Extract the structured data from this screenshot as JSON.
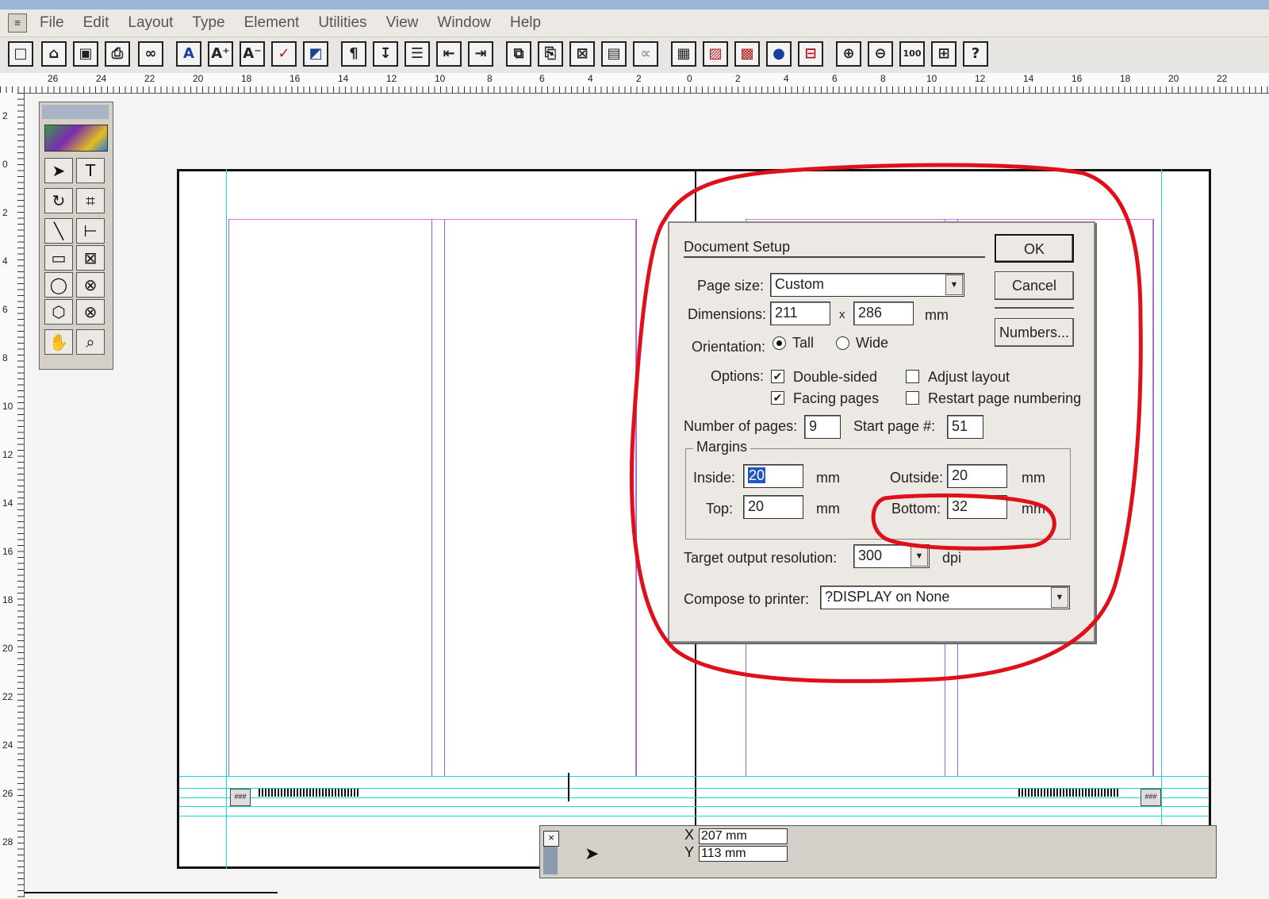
{
  "menubar": {
    "items": [
      "File",
      "Edit",
      "Layout",
      "Type",
      "Element",
      "Utilities",
      "View",
      "Window",
      "Help"
    ]
  },
  "rulers": {
    "horizontal_ticks": [
      "26",
      "24",
      "22",
      "20",
      "18",
      "16",
      "14",
      "12",
      "10",
      "8",
      "6",
      "4",
      "2",
      "0",
      "2",
      "4",
      "6",
      "8",
      "10",
      "12",
      "14",
      "16",
      "18",
      "20",
      "22"
    ],
    "vertical_ticks": [
      "2",
      "0",
      "2",
      "4",
      "6",
      "8",
      "10",
      "12",
      "14",
      "16",
      "18",
      "20",
      "22",
      "24",
      "26",
      "28"
    ]
  },
  "dialog": {
    "title": "Document Setup",
    "page_size_label": "Page size:",
    "page_size_value": "Custom",
    "dimensions_label": "Dimensions:",
    "width": "211",
    "by": "x",
    "height": "286",
    "unit": "mm",
    "orientation_label": "Orientation:",
    "orientation_tall": "Tall",
    "orientation_wide": "Wide",
    "options_label": "Options:",
    "double_sided": "Double-sided",
    "facing_pages": "Facing pages",
    "adjust_layout": "Adjust layout",
    "restart_numbering": "Restart page numbering",
    "num_pages_label": "Number of pages:",
    "num_pages": "9",
    "start_page_label": "Start page #:",
    "start_page": "51",
    "margins_label": "Margins",
    "inside_label": "Inside:",
    "inside": "20",
    "outside_label": "Outside:",
    "outside": "20",
    "top_label": "Top:",
    "top": "20",
    "bottom_label": "Bottom:",
    "bottom": "32",
    "resolution_label": "Target output resolution:",
    "resolution": "300",
    "dpi": "dpi",
    "compose_label": "Compose to printer:",
    "compose_value": "?DISPLAY on None",
    "ok": "OK",
    "cancel": "Cancel",
    "numbers": "Numbers..."
  },
  "control_palette": {
    "x_label": "X",
    "x_value": "207 mm",
    "y_label": "Y",
    "y_value": "113 mm"
  },
  "colors": {
    "annotation_red": "#e0101a",
    "margin_magenta": "#e070e0",
    "column_guide_violet": "#7b6ee8",
    "ruler_guide_cyan": "#19d6d6"
  }
}
